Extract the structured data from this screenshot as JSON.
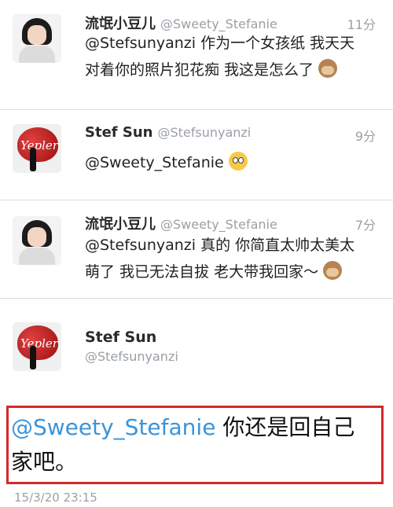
{
  "tweets": [
    {
      "name": "流氓小豆儿",
      "handle": "@Sweety_Stefanie",
      "time": "11分",
      "line1": "@Stefsunyanzi 作为一个女孩纸 我天天",
      "line2": "对着你的照片犯花痴 我这是怎么了",
      "emoji": "see-no-evil-monkey"
    },
    {
      "name": "Stef Sun",
      "handle": "@Stefsunyanzi",
      "time": "9分",
      "line1": "@Sweety_Stefanie",
      "emoji": "flushed-face"
    },
    {
      "name": "流氓小豆儿",
      "handle": "@Sweety_Stefanie",
      "time": "7分",
      "line1": "@Stefsunyanzi 真的 你简直太帅太美太",
      "line2": "萌了 我已无法自拔 老大带我回家～",
      "emoji": "see-no-evil-monkey"
    }
  ],
  "detail": {
    "name": "Stef Sun",
    "handle": "@Stefsunyanzi",
    "mention": "@Sweety_Stefanie",
    "text_after_mention": " 你还是回自己",
    "line2": "家吧。",
    "timestamp": "15/3/20 23:15",
    "highlight_color": "#d22a2a",
    "mention_color": "#3b94d9"
  },
  "avatar_text": "Yepler"
}
